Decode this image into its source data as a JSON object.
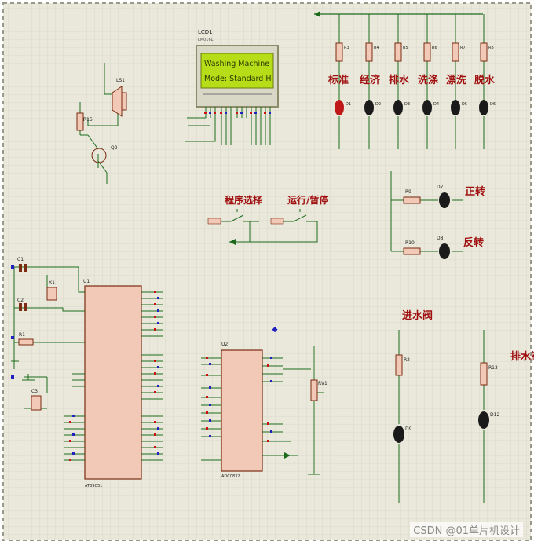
{
  "colors": {
    "sheet": "#e9e8da",
    "grid": "#d0cfbf",
    "wire": "#1c6b1c",
    "chip": "#f2c9b6",
    "chip_stroke": "#7a2b12",
    "led_body": "#1a1a1a",
    "led_red": "#c01818",
    "label_red": "#a01010",
    "lcd_screen": "#b5dd18",
    "lcd_text": "#2b3a00",
    "lcd_frame": "#8c8c6a",
    "pin_red": "#d01010",
    "pin_blue": "#2020c0"
  },
  "lcd": {
    "ref": "LCD1",
    "part": "LM016L",
    "line1": "Washing Machine",
    "line2": "Mode: Standard H"
  },
  "mode_leds": [
    {
      "ref": "R3",
      "led": "D1",
      "label": "标准"
    },
    {
      "ref": "R4",
      "led": "D2",
      "label": "经济"
    },
    {
      "ref": "R5",
      "led": "D3",
      "label": "排水"
    },
    {
      "ref": "R6",
      "led": "D4",
      "label": "洗涤"
    },
    {
      "ref": "R7",
      "led": "D5",
      "label": "漂洗"
    },
    {
      "ref": "R8",
      "led": "D6",
      "label": "脱水"
    }
  ],
  "motor_leds": [
    {
      "ref": "R9",
      "led": "D7",
      "label": "正转"
    },
    {
      "ref": "R10",
      "led": "D8",
      "label": "反转"
    }
  ],
  "buttons": {
    "program": "程序选择",
    "run": "运行/暂停"
  },
  "valves": {
    "inlet": "进水阀",
    "drain": "排水阀",
    "inlet_r": "R2",
    "drain_r": "R13",
    "inlet_led": "D9",
    "drain_led": "D12"
  },
  "buzzer": {
    "resistor": "R15",
    "speaker": "LS1",
    "transistor": "Q2"
  },
  "mcu": {
    "ref": "U1",
    "part": "AT89C51"
  },
  "adc": {
    "ref": "U2",
    "part": "ADC0832",
    "pot": "RV1"
  },
  "caps": {
    "c1": "C1",
    "c2": "C2",
    "c3": "C3",
    "xtal": "X1",
    "r1": "R1"
  },
  "watermark": "CSDN @01单片机设计"
}
